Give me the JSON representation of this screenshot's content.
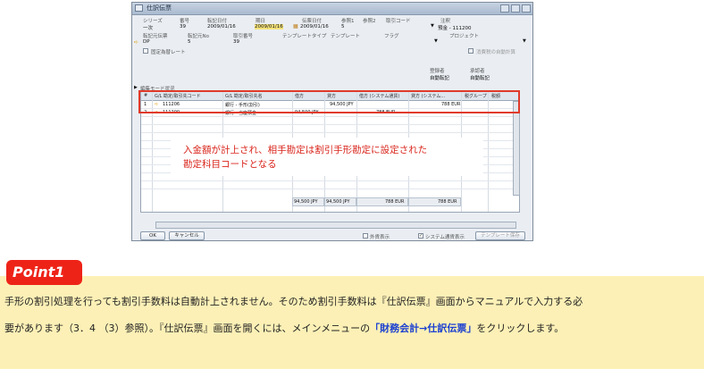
{
  "window": {
    "title": "仕訳伝票",
    "fields_row1_labels": [
      "シリーズ",
      "番号",
      "転記日付",
      "期日",
      "伝票日付",
      "参照1",
      "参照2",
      "取引コード",
      "注釈"
    ],
    "fields_row1_values": [
      "一次",
      "39",
      "2009/01/16",
      "2009/01/16",
      "2009/01/16",
      "5",
      "",
      "",
      "預金 - 111200"
    ],
    "fields_row2_labels": [
      "転記元伝票",
      "転記元No",
      "取引番号",
      "テンプレートタイプ",
      "テンプレート",
      "フラグ",
      "",
      "プロジェクト"
    ],
    "row2_values": [
      "DP",
      "5",
      "39"
    ],
    "fixed_rate_label": "固定為替レート",
    "auto_tax_label": "消費税の自動計算",
    "registrant_label": "登録者",
    "registrant_value": "自動転記",
    "approver_label": "承認者",
    "approver_value": "自動転記",
    "edit_mode_label": "編集モード状況"
  },
  "grid": {
    "headers": [
      "#",
      "G/L 勘定/取引先コード",
      "G/L 勘定/取引先名",
      "借方",
      "貸方",
      "借方 (システム通貨)",
      "貸方 (システム...",
      "税グループ",
      "税額"
    ],
    "rows": [
      {
        "num": "1",
        "code": "111206",
        "name": "銀行 - 手形(割引)",
        "debit": "",
        "credit": "94,500 JPY",
        "debit_sys": "",
        "credit_sys": "788 EUR"
      },
      {
        "num": "2",
        "code": "111200",
        "name": "銀行 - 当座預金",
        "debit": "94,500 JPY",
        "credit": "",
        "debit_sys": "788 EUR",
        "credit_sys": ""
      }
    ],
    "totals": [
      "94,500 JPY",
      "94,500 JPY",
      "788 EUR",
      "788 EUR"
    ]
  },
  "callout": {
    "line1": "入金額が計上され、相手勘定は割引手形勘定に設定された",
    "line2": "勘定科目コードとなる"
  },
  "buttons": {
    "ok": "OK",
    "cancel": "キャンセル",
    "template_save": "テンプレート保存"
  },
  "bottom_checks": {
    "fc_display": "外貨表示",
    "sys_display": "システム通貨表示"
  },
  "point": {
    "badge": "Point1",
    "line1": "手形の割引処理を行っても割引手数料は自動計上されません。そのため割引手数料は『仕訳伝票』画面からマニュアルで入力する必",
    "line2_pre": "要があります（3．4 （3）参照）。『仕訳伝票』画面を開くには、メインメニューの",
    "line2_blue": "「財務会計→仕訳伝票」",
    "line2_post": "をクリックします。"
  },
  "colors": {
    "accent_red": "#e03a2a",
    "highlight": "#f4e27a",
    "band": "#fcf0b6",
    "link_blue": "#1a3fd1"
  }
}
